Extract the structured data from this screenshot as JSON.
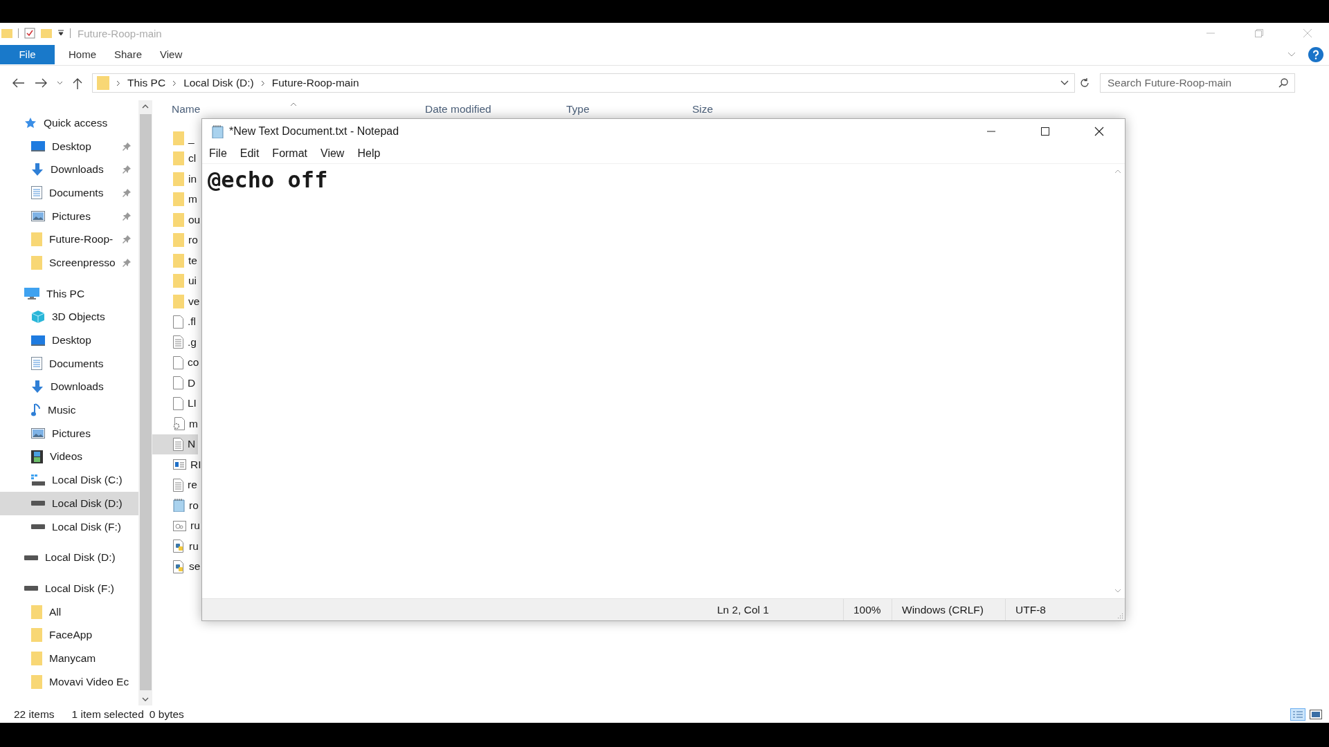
{
  "explorer": {
    "title": "Future-Roop-main",
    "file_tab": "File",
    "ribbon_tabs": [
      "Home",
      "Share",
      "View"
    ],
    "breadcrumb": [
      "This PC",
      "Local Disk (D:)",
      "Future-Roop-main"
    ],
    "search": {
      "placeholder": "Search Future-Roop-main"
    },
    "columns": [
      "Name",
      "Date modified",
      "Type",
      "Size"
    ],
    "sidebar": [
      {
        "label": "Quick access",
        "kind": "star",
        "selected": false,
        "children": [
          {
            "label": "Desktop",
            "kind": "desktop",
            "pinned": true,
            "selected": false
          },
          {
            "label": "Downloads",
            "kind": "download",
            "pinned": true,
            "selected": false
          },
          {
            "label": "Documents",
            "kind": "document",
            "pinned": true,
            "selected": false
          },
          {
            "label": "Pictures",
            "kind": "pictures",
            "pinned": true,
            "selected": false
          },
          {
            "label": "Future-Roop-",
            "kind": "folder",
            "pinned": true,
            "selected": false
          },
          {
            "label": "Screenpresso",
            "kind": "folder",
            "pinned": true,
            "selected": false
          }
        ]
      },
      {
        "label": "This PC",
        "kind": "pc",
        "selected": false,
        "children": [
          {
            "label": "3D Objects",
            "kind": "cube",
            "selected": false
          },
          {
            "label": "Desktop",
            "kind": "desktop",
            "selected": false
          },
          {
            "label": "Documents",
            "kind": "document",
            "selected": false
          },
          {
            "label": "Downloads",
            "kind": "download",
            "selected": false
          },
          {
            "label": "Music",
            "kind": "music",
            "selected": false
          },
          {
            "label": "Pictures",
            "kind": "pictures",
            "selected": false
          },
          {
            "label": "Videos",
            "kind": "video",
            "selected": false
          },
          {
            "label": "Local Disk (C:)",
            "kind": "drive-os",
            "selected": false
          },
          {
            "label": "Local Disk (D:)",
            "kind": "drive",
            "selected": true
          },
          {
            "label": "Local Disk (F:)",
            "kind": "drive",
            "selected": false
          }
        ]
      },
      {
        "label": "Local Disk (D:)",
        "kind": "drive",
        "selected": false
      },
      {
        "label": "Local Disk (F:)",
        "kind": "drive",
        "selected": false,
        "children": [
          {
            "label": "All",
            "kind": "folder",
            "selected": false
          },
          {
            "label": "FaceApp",
            "kind": "folder",
            "selected": false
          },
          {
            "label": "Manycam",
            "kind": "folder",
            "selected": false
          },
          {
            "label": "Movavi Video Ec",
            "kind": "folder",
            "selected": false
          }
        ]
      }
    ],
    "files": [
      {
        "name": "_",
        "kind": "folder",
        "selected": false
      },
      {
        "name": "cl",
        "kind": "folder",
        "selected": false
      },
      {
        "name": "in",
        "kind": "folder",
        "selected": false
      },
      {
        "name": "m",
        "kind": "folder",
        "selected": false
      },
      {
        "name": "ou",
        "kind": "folder",
        "selected": false
      },
      {
        "name": "ro",
        "kind": "folder",
        "selected": false
      },
      {
        "name": "te",
        "kind": "folder",
        "selected": false
      },
      {
        "name": "ui",
        "kind": "folder",
        "selected": false
      },
      {
        "name": "ve",
        "kind": "folder",
        "selected": false
      },
      {
        "name": ".fl",
        "kind": "blank",
        "selected": false
      },
      {
        "name": ".g",
        "kind": "text",
        "selected": false
      },
      {
        "name": "co",
        "kind": "blank",
        "selected": false
      },
      {
        "name": "D",
        "kind": "blank",
        "selected": false
      },
      {
        "name": "LI",
        "kind": "blank",
        "selected": false
      },
      {
        "name": "m",
        "kind": "gear",
        "selected": false
      },
      {
        "name": "N",
        "kind": "text",
        "selected": true
      },
      {
        "name": "RI",
        "kind": "window",
        "selected": false
      },
      {
        "name": "re",
        "kind": "text",
        "selected": false
      },
      {
        "name": "ro",
        "kind": "notepad",
        "selected": false
      },
      {
        "name": "ru",
        "kind": "settings",
        "selected": false
      },
      {
        "name": "ru",
        "kind": "python",
        "selected": false
      },
      {
        "name": "se",
        "kind": "python",
        "selected": false
      }
    ],
    "status": {
      "count": "22 items",
      "selection": "1 item selected",
      "size": "0 bytes"
    }
  },
  "notepad": {
    "title": "*New Text Document.txt - Notepad",
    "menu": [
      "File",
      "Edit",
      "Format",
      "View",
      "Help"
    ],
    "content": "@echo off",
    "status": [
      "Ln 2, Col 1",
      "100%",
      "Windows (CRLF)",
      "UTF-8"
    ]
  }
}
